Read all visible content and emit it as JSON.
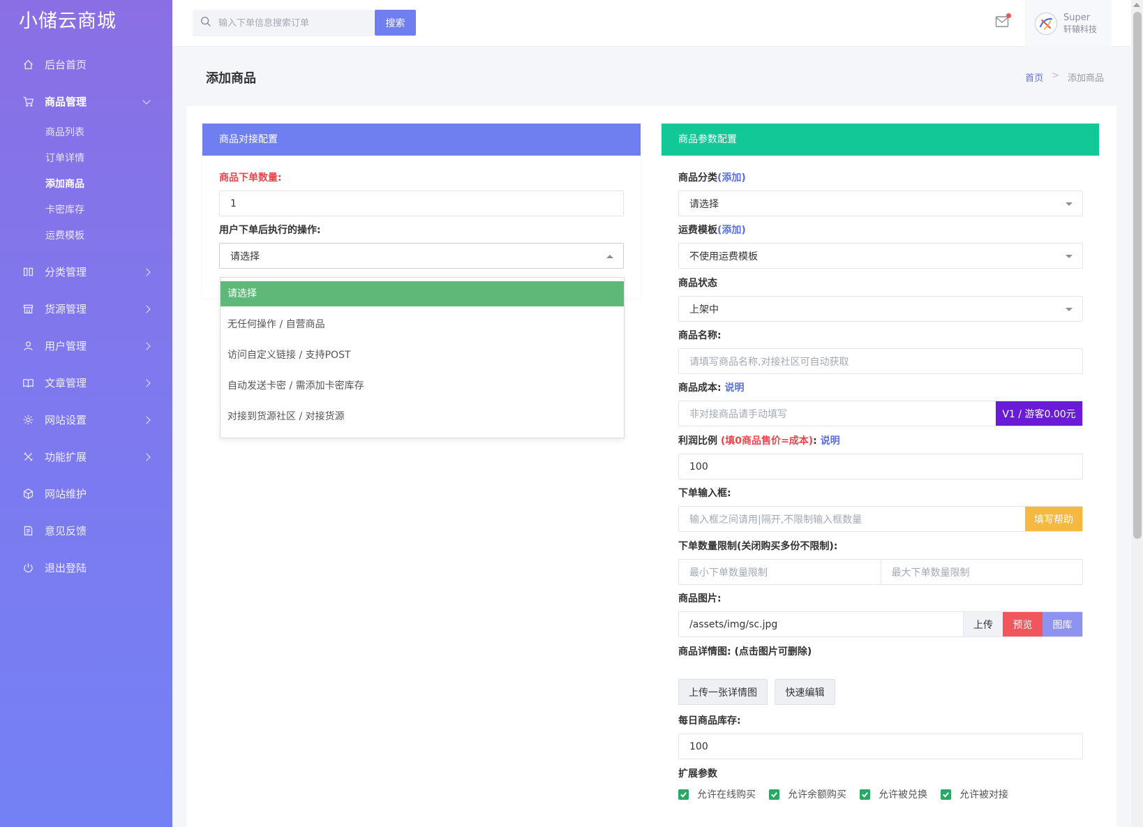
{
  "app": {
    "logo": "小储云商城"
  },
  "sidebar": {
    "items": [
      {
        "label": "后台首页",
        "icon": "home-icon"
      },
      {
        "label": "商品管理",
        "icon": "cart-icon"
      },
      {
        "label": "分类管理",
        "icon": "columns-icon"
      },
      {
        "label": "货源管理",
        "icon": "store-icon"
      },
      {
        "label": "用户管理",
        "icon": "user-icon"
      },
      {
        "label": "文章管理",
        "icon": "book-icon"
      },
      {
        "label": "网站设置",
        "icon": "gear-icon"
      },
      {
        "label": "功能扩展",
        "icon": "tools-icon"
      },
      {
        "label": "网站维护",
        "icon": "box-icon"
      },
      {
        "label": "意见反馈",
        "icon": "feedback-icon"
      },
      {
        "label": "退出登陆",
        "icon": "power-icon"
      }
    ],
    "subitems": [
      "商品列表",
      "订单详情",
      "添加商品",
      "卡密库存",
      "运费模板"
    ]
  },
  "header": {
    "search_placeholder": "输入下单信息搜索订单",
    "search_button": "搜索",
    "user_name": "Super",
    "user_company": "轩辕科技"
  },
  "page": {
    "title": "添加商品",
    "breadcrumb_home": "首页",
    "breadcrumb_sep": ">",
    "breadcrumb_current": "添加商品"
  },
  "left_panel": {
    "title": "商品对接配置",
    "qty_label": "商品下单数量:",
    "qty_value": "1",
    "action_label": "用户下单后执行的操作:",
    "action_value": "请选择",
    "options": [
      "请选择",
      "无任何操作 / 自营商品",
      "访问自定义链接 / 支持POST",
      "自动发送卡密 / 需添加卡密库存",
      "对接到货源社区 / 对接货源"
    ]
  },
  "right_panel": {
    "title": "商品参数配置",
    "category_label": "商品分类",
    "category_add": "(添加)",
    "category_value": "请选择",
    "shipping_label": "运费模板",
    "shipping_add": "(添加)",
    "shipping_value": "不使用运费模板",
    "status_label": "商品状态",
    "status_value": "上架中",
    "name_label": "商品名称:",
    "name_placeholder": "请填写商品名称,对接社区可自动获取",
    "cost_label": "商品成本:",
    "cost_link": "说明",
    "cost_placeholder": "非对接商品请手动填写",
    "cost_addon": "V1 / 游客0.00元",
    "profit_label": "利润比例",
    "profit_hint": "(填0商品售价=成本)",
    "profit_colon": ":",
    "profit_link": "说明",
    "profit_value": "100",
    "order_input_label": "下单输入框:",
    "order_input_placeholder": "输入框之间请用|隔开,不限制输入框数量",
    "order_input_help": "填写帮助",
    "limit_label": "下单数量限制(关闭购买多份不限制):",
    "limit_min_placeholder": "最小下单数量限制",
    "limit_max_placeholder": "最大下单数量限制",
    "image_label": "商品图片:",
    "image_value": "/assets/img/sc.jpg",
    "upload_btn": "上传",
    "preview_btn": "预览",
    "gallery_btn": "图库",
    "detail_label": "商品详情图: (点击图片可删除)",
    "upload_detail_btn": "上传一张详情图",
    "quick_edit_btn": "快速编辑",
    "stock_label": "每日商品库存:",
    "stock_value": "100",
    "ext_label": "扩展参数",
    "checkboxes": [
      "允许在线购买",
      "允许余额购买",
      "允许被兑换",
      "允许被对接"
    ]
  },
  "colors": {
    "sidebar_gradient_top": "#8a6fe4",
    "sidebar_gradient_bottom": "#7481f5",
    "primary": "#6f7ff0",
    "green_panel": "#12c896",
    "dropdown_selected": "#5fb878",
    "cost_addon": "#6a1bd6",
    "help_addon": "#f5b942",
    "preview_btn": "#f0565c",
    "gallery_btn": "#8e93f0",
    "checkbox": "#2aa866"
  }
}
